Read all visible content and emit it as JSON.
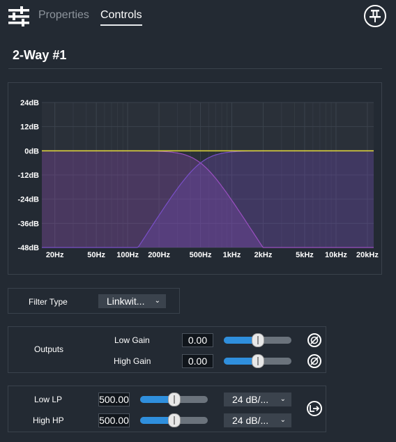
{
  "header": {
    "tabs": [
      {
        "label": "Properties",
        "active": false
      },
      {
        "label": "Controls",
        "active": true
      }
    ],
    "icons": {
      "menu": "sliders-icon",
      "pin": "pin-icon"
    }
  },
  "block": {
    "title": "2-Way #1"
  },
  "chart_data": {
    "type": "line",
    "title": "",
    "xlabel": "",
    "ylabel": "",
    "x_scale": "log",
    "xlim": [
      15,
      23000
    ],
    "ylim": [
      -48,
      24
    ],
    "y_ticks": [
      "24dB",
      "12dB",
      "0dB",
      "-12dB",
      "-24dB",
      "-36dB",
      "-48dB"
    ],
    "x_ticks": [
      {
        "label": "20Hz",
        "value": 20
      },
      {
        "label": "50Hz",
        "value": 50
      },
      {
        "label": "100Hz",
        "value": 100
      },
      {
        "label": "200Hz",
        "value": 200
      },
      {
        "label": "500Hz",
        "value": 500
      },
      {
        "label": "1kHz",
        "value": 1000
      },
      {
        "label": "2kHz",
        "value": 2000
      },
      {
        "label": "5kHz",
        "value": 5000
      },
      {
        "label": "10kHz",
        "value": 10000
      },
      {
        "label": "20kHz",
        "value": 20000
      }
    ],
    "grid": true,
    "series": [
      {
        "role": "low-pass",
        "type": "lowpass",
        "cutoff_hz": 500,
        "slope_db_per_oct": 24,
        "color": "#9a4fc1"
      },
      {
        "role": "high-pass",
        "type": "highpass",
        "cutoff_hz": 500,
        "slope_db_per_oct": 24,
        "color": "#7a4fc8"
      },
      {
        "role": "sum",
        "type": "flat",
        "value_db": 0,
        "color": "#e5dc3a"
      }
    ]
  },
  "filter_type": {
    "label": "Filter Type",
    "value": "Linkwit..."
  },
  "outputs": {
    "label": "Outputs",
    "rows": [
      {
        "label": "Low Gain",
        "value": "0.00",
        "slider": 0.5,
        "icon": "polarity-invert-icon"
      },
      {
        "label": "High Gain",
        "value": "0.00",
        "slider": 0.5,
        "icon": "polarity-invert-icon"
      }
    ]
  },
  "crossover": {
    "rows": [
      {
        "label": "Low LP",
        "value": "500.00",
        "slider": 0.5,
        "slope": "24 dB/..."
      },
      {
        "label": "High HP",
        "value": "500.00",
        "slider": 0.5,
        "slope": "24 dB/..."
      }
    ],
    "link_icon": "link-arrow-icon"
  },
  "colors": {
    "accent": "#2f8fdd",
    "background": "#232a33",
    "panel_border": "#3a424c"
  }
}
